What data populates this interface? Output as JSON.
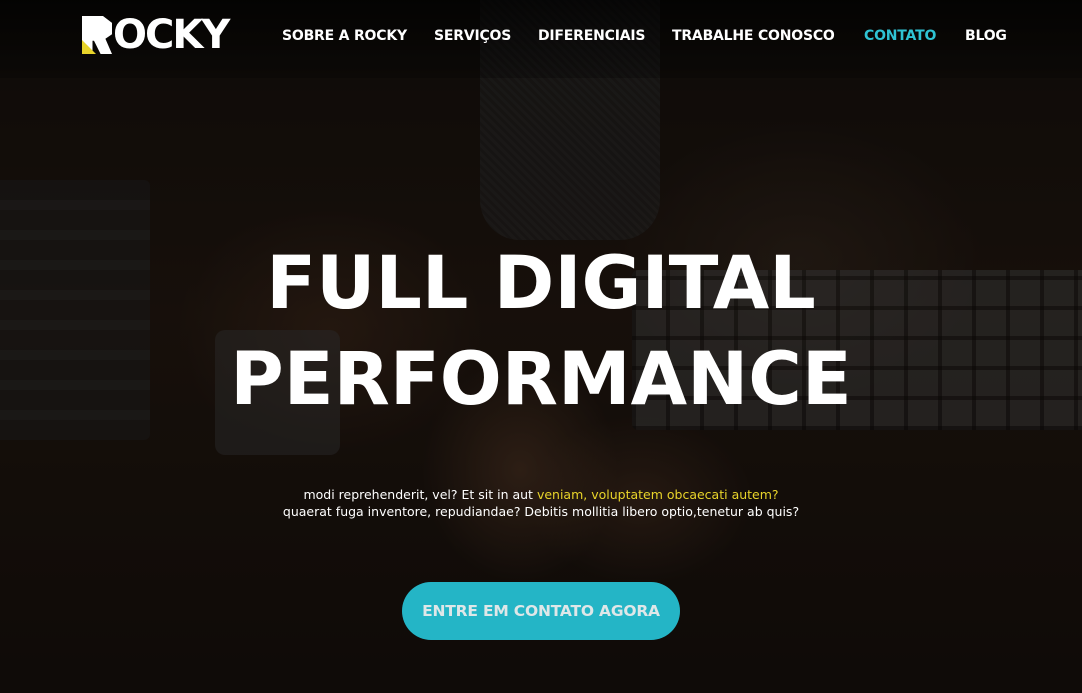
{
  "brand": {
    "name": "ROCKY",
    "logo_text": "OCKY",
    "accent_color": "#e8d42a",
    "primary_color": "#24b5c6"
  },
  "nav": {
    "items": [
      {
        "label": "SOBRE A ROCKY",
        "active": false
      },
      {
        "label": "SERVIÇOS",
        "active": false
      },
      {
        "label": "DIFERENCIAIS",
        "active": false
      },
      {
        "label": "TRABALHE CONOSCO",
        "active": false
      },
      {
        "label": "CONTATO",
        "active": true
      },
      {
        "label": "BLOG",
        "active": false
      }
    ],
    "active_color": "#2fc3d3"
  },
  "hero": {
    "headline_line1": "FULL DIGITAL",
    "headline_line2": "PERFORMANCE",
    "subtext": {
      "line1_part1": "modi reprehenderit, vel? Et sit in aut ",
      "line1_highlight": "veniam, voluptatem obcaecati autem?",
      "line2": "quaerat fuga inventore, repudiandae? Debitis mollitia libero optio,tenetur ab quis?"
    },
    "cta_label": "ENTRE EM CONTATO AGORA"
  }
}
